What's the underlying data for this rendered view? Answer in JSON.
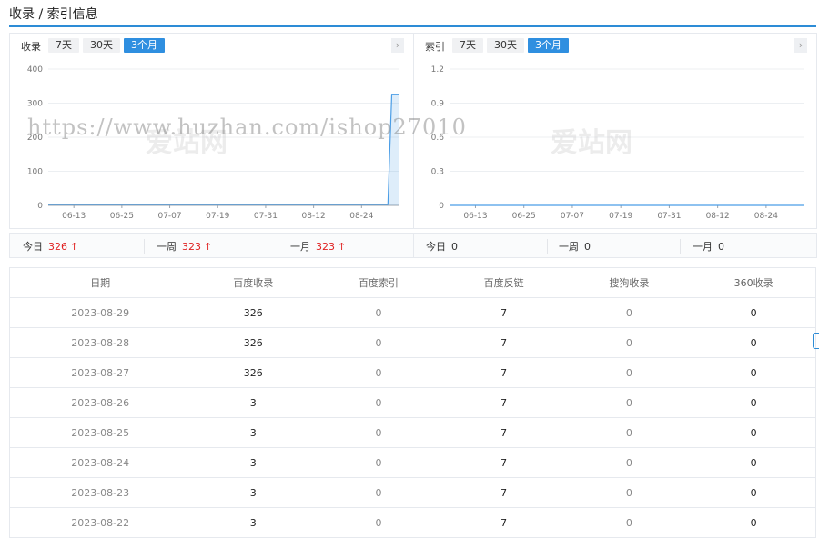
{
  "page": {
    "title": "收录 / 索引信息"
  },
  "inclusion_panel": {
    "label": "收录",
    "tabs": [
      "7天",
      "30天",
      "3个月"
    ],
    "active_tab": 2,
    "nav_icon": "chevron-right-icon"
  },
  "index_panel": {
    "label": "索引",
    "tabs": [
      "7天",
      "30天",
      "3个月"
    ],
    "active_tab": 2,
    "nav_icon": "chevron-right-icon"
  },
  "chart_data": [
    {
      "type": "area",
      "ylim": [
        0,
        400
      ],
      "yticks": [
        "0",
        "100",
        "200",
        "300",
        "400"
      ],
      "xticks": [
        "06-13",
        "06-25",
        "07-07",
        "07-19",
        "07-31",
        "08-12",
        "08-24"
      ],
      "series": [
        {
          "values": [
            3,
            3,
            3,
            3,
            3,
            3,
            3,
            3,
            3,
            3,
            3,
            3,
            3,
            3,
            3,
            3,
            3,
            3,
            3,
            3,
            3,
            3,
            3,
            3,
            3,
            3,
            3,
            3,
            3,
            3,
            3,
            3,
            3,
            3,
            3,
            3,
            3,
            3,
            3,
            3,
            3,
            3,
            3,
            3,
            3,
            3,
            3,
            3,
            3,
            3,
            3,
            3,
            3,
            3,
            3,
            3,
            3,
            3,
            3,
            3,
            3,
            3,
            3,
            3,
            3,
            3,
            3,
            3,
            3,
            3,
            3,
            3,
            3,
            3,
            3,
            3,
            3,
            3,
            3,
            3,
            3,
            3,
            3,
            3,
            3,
            3,
            3,
            3,
            3,
            326,
            326,
            326
          ]
        }
      ],
      "color": "#4a9de6"
    },
    {
      "type": "line",
      "ylim": [
        0,
        1.2
      ],
      "yticks": [
        "0",
        "0.3",
        "0.6",
        "0.9",
        "1.2"
      ],
      "xticks": [
        "06-13",
        "06-25",
        "07-07",
        "07-19",
        "07-31",
        "08-12",
        "08-24"
      ],
      "series": [
        {
          "values": [
            0,
            0
          ]
        }
      ],
      "color": "#4a9de6"
    }
  ],
  "inclusion_stats": {
    "today_label": "今日",
    "today_value": "326",
    "week_label": "一周",
    "week_value": "323",
    "month_label": "一月",
    "month_value": "323",
    "arrow": "↑"
  },
  "index_stats": {
    "today_label": "今日",
    "today_value": "0",
    "week_label": "一周",
    "week_value": "0",
    "month_label": "一月",
    "month_value": "0"
  },
  "table": {
    "headers": [
      "日期",
      "百度收录",
      "百度索引",
      "百度反链",
      "搜狗收录",
      "360收录"
    ],
    "rows": [
      [
        "2023-08-29",
        "326",
        "0",
        "7",
        "0",
        "0"
      ],
      [
        "2023-08-28",
        "326",
        "0",
        "7",
        "0",
        "0"
      ],
      [
        "2023-08-27",
        "326",
        "0",
        "7",
        "0",
        "0"
      ],
      [
        "2023-08-26",
        "3",
        "0",
        "7",
        "0",
        "0"
      ],
      [
        "2023-08-25",
        "3",
        "0",
        "7",
        "0",
        "0"
      ],
      [
        "2023-08-24",
        "3",
        "0",
        "7",
        "0",
        "0"
      ],
      [
        "2023-08-23",
        "3",
        "0",
        "7",
        "0",
        "0"
      ],
      [
        "2023-08-22",
        "3",
        "0",
        "7",
        "0",
        "0"
      ]
    ]
  },
  "watermark": {
    "url": "https://www.huzhan.com/ishop27010",
    "logo": "爱站网"
  }
}
